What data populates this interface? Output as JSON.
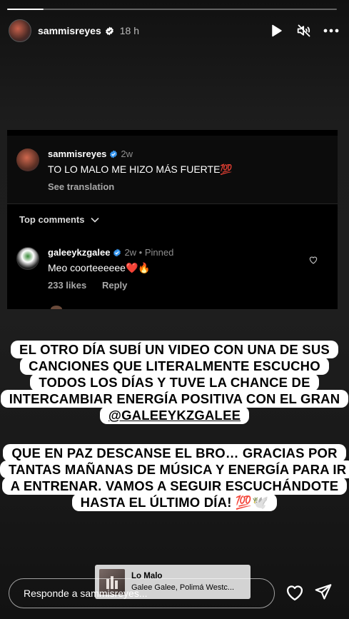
{
  "story": {
    "progress_fraction": 0.11,
    "username": "sammisreyes",
    "time": "18 h",
    "icons": {
      "play": "play-icon",
      "mute": "speaker-muted-icon",
      "more": "more-icon"
    }
  },
  "screenshot": {
    "post": {
      "username": "sammisreyes",
      "time": "2w",
      "text": "TO LO MALO ME HIZO MÁS FUERTE💯",
      "see_translation": "See translation"
    },
    "top_comments_label": "Top comments",
    "comment": {
      "username": "galeeykzgalee",
      "meta": "2w • Pinned",
      "text": "Meo coorteeeeee❤️🔥",
      "likes": "233 likes",
      "reply": "Reply"
    }
  },
  "captions": {
    "block1_text": "EL OTRO DÍA SUBÍ UN VIDEO CON UNA DE SUS CANCIONES QUE LITERALMENTE ESCUCHO TODOS LOS DÍAS Y TUVE LA CHANCE DE INTERCAMBIAR ENERGÍA POSITIVA CON EL GRAN ",
    "block1_mention": "@GALEEYKZGALEE",
    "block2_text": "QUE EN PAZ DESCANSE EL BRO… GRACIAS POR TANTAS MAÑANAS DE MÚSICA Y ENERGÍA PARA IR A ENTRENAR. VAMOS A SEGUIR ESCUCHÁNDOTE HASTA EL ÚLTIMO DÍA! 💯🕊️"
  },
  "music": {
    "title": "Lo Malo",
    "artist": "Galee Galee, Polimá Westc..."
  },
  "reply": {
    "placeholder": "Responde a sammisreyes..."
  },
  "colors": {
    "verified": "#3897f0",
    "caption_bg": "#ffffff",
    "caption_text": "#000000",
    "music_bg": "#d3d3d3"
  }
}
